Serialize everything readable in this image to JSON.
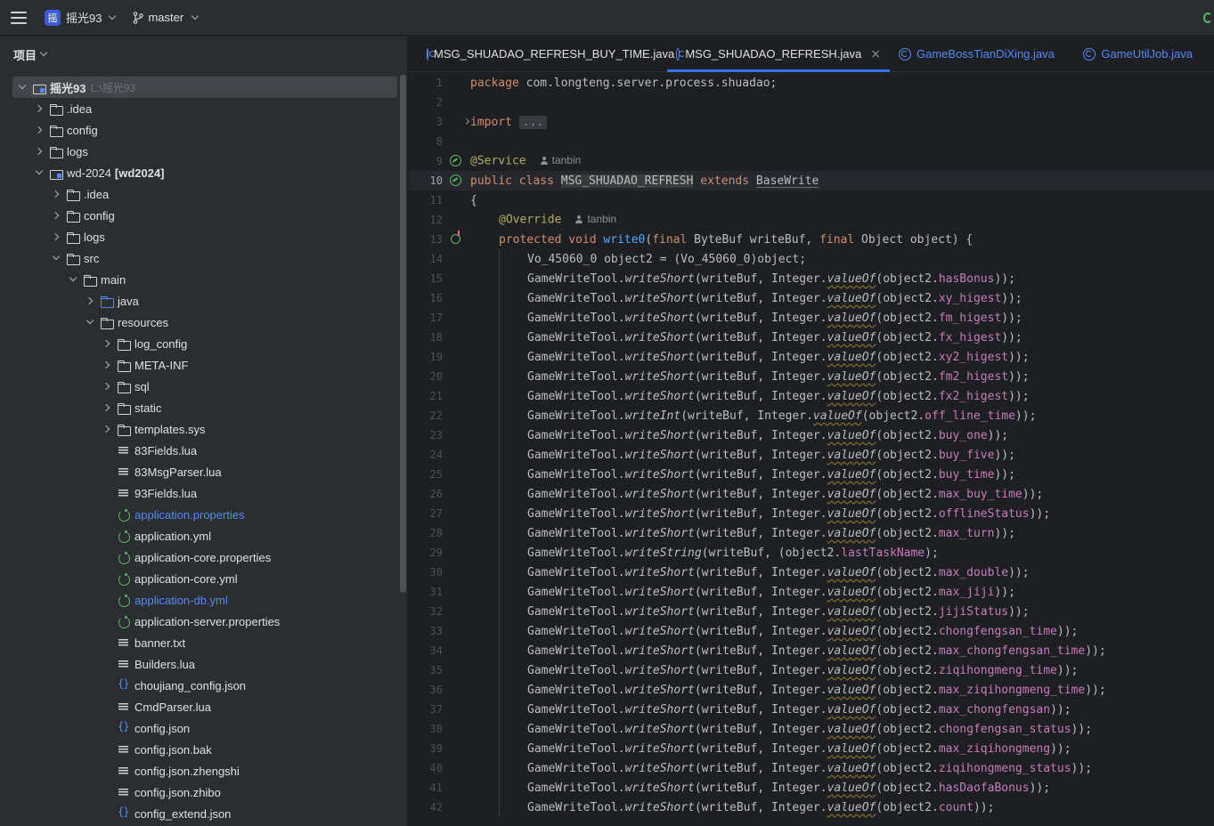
{
  "toolbar": {
    "project_badge": "摇",
    "project_name": "摇光93",
    "branch": "master"
  },
  "project_panel": {
    "title": "项目",
    "root": {
      "name": "摇光93",
      "path": "L:\\摇光93"
    },
    "tree": [
      {
        "depth": 1,
        "arrow": "closed",
        "icon": "folder",
        "label": ".idea"
      },
      {
        "depth": 1,
        "arrow": "closed",
        "icon": "folder",
        "label": "config"
      },
      {
        "depth": 1,
        "arrow": "closed",
        "icon": "folder",
        "label": "logs"
      },
      {
        "depth": 1,
        "arrow": "open",
        "icon": "module",
        "label": "wd-2024",
        "module": "[wd2024]"
      },
      {
        "depth": 2,
        "arrow": "closed",
        "icon": "folder",
        "label": ".idea"
      },
      {
        "depth": 2,
        "arrow": "closed",
        "icon": "folder",
        "label": "config"
      },
      {
        "depth": 2,
        "arrow": "closed",
        "icon": "folder",
        "label": "logs"
      },
      {
        "depth": 2,
        "arrow": "open",
        "icon": "folder",
        "label": "src"
      },
      {
        "depth": 3,
        "arrow": "open",
        "icon": "folder",
        "label": "main"
      },
      {
        "depth": 4,
        "arrow": "closed",
        "icon": "folder-blue",
        "label": "java"
      },
      {
        "depth": 4,
        "arrow": "open",
        "icon": "folder",
        "label": "resources"
      },
      {
        "depth": 5,
        "arrow": "closed",
        "icon": "folder",
        "label": "log_config"
      },
      {
        "depth": 5,
        "arrow": "closed",
        "icon": "folder",
        "label": "META-INF"
      },
      {
        "depth": 5,
        "arrow": "closed",
        "icon": "folder",
        "label": "sql"
      },
      {
        "depth": 5,
        "arrow": "closed",
        "icon": "folder",
        "label": "static"
      },
      {
        "depth": 5,
        "arrow": "closed",
        "icon": "folder",
        "label": "templates.sys"
      },
      {
        "depth": 5,
        "arrow": "none",
        "icon": "text",
        "label": "83Fields.lua"
      },
      {
        "depth": 5,
        "arrow": "none",
        "icon": "text",
        "label": "83MsgParser.lua"
      },
      {
        "depth": 5,
        "arrow": "none",
        "icon": "text",
        "label": "93Fields.lua"
      },
      {
        "depth": 5,
        "arrow": "none",
        "icon": "spring",
        "label": "application.properties",
        "color": "blue"
      },
      {
        "depth": 5,
        "arrow": "none",
        "icon": "spring",
        "label": "application.yml"
      },
      {
        "depth": 5,
        "arrow": "none",
        "icon": "spring",
        "label": "application-core.properties"
      },
      {
        "depth": 5,
        "arrow": "none",
        "icon": "spring",
        "label": "application-core.yml"
      },
      {
        "depth": 5,
        "arrow": "none",
        "icon": "spring",
        "label": "application-db.yml",
        "color": "blue"
      },
      {
        "depth": 5,
        "arrow": "none",
        "icon": "spring",
        "label": "application-server.properties"
      },
      {
        "depth": 5,
        "arrow": "none",
        "icon": "text",
        "label": "banner.txt"
      },
      {
        "depth": 5,
        "arrow": "none",
        "icon": "text",
        "label": "Builders.lua"
      },
      {
        "depth": 5,
        "arrow": "none",
        "icon": "json",
        "label": "choujiang_config.json"
      },
      {
        "depth": 5,
        "arrow": "none",
        "icon": "text",
        "label": "CmdParser.lua"
      },
      {
        "depth": 5,
        "arrow": "none",
        "icon": "json",
        "label": "config.json"
      },
      {
        "depth": 5,
        "arrow": "none",
        "icon": "text",
        "label": "config.json.bak"
      },
      {
        "depth": 5,
        "arrow": "none",
        "icon": "text",
        "label": "config.json.zhengshi"
      },
      {
        "depth": 5,
        "arrow": "none",
        "icon": "text",
        "label": "config.json.zhibo"
      },
      {
        "depth": 5,
        "arrow": "none",
        "icon": "json",
        "label": "config_extend.json"
      }
    ]
  },
  "editor": {
    "tabs": [
      {
        "label": "MSG_SHUADAO_REFRESH_BUY_TIME.java",
        "active": false,
        "blue": false
      },
      {
        "label": "MSG_SHUADAO_REFRESH.java",
        "active": true,
        "blue": false,
        "close": "×"
      },
      {
        "label": "GameBossTianDiXing.java",
        "active": false,
        "blue": true
      },
      {
        "label": "GameUtilJob.java",
        "active": false,
        "blue": true
      }
    ],
    "header_lines": {
      "l1": {
        "num": "1",
        "kw": "package",
        "rest": " com.longteng.server.process.shuadao;"
      },
      "l2": {
        "num": "2"
      },
      "l3": {
        "num": "3",
        "kw": "import",
        "fold": "..."
      },
      "l8": {
        "num": "8"
      },
      "l9": {
        "num": "9",
        "ann": "@Service",
        "author": "tanbin"
      },
      "l10": {
        "num": "10",
        "kw1": "public class",
        "cls": "MSG_SHUADAO_REFRESH",
        "kw2": "extends",
        "base": "BaseWrite"
      },
      "l11": {
        "num": "11",
        "text": "{"
      },
      "l12": {
        "num": "12",
        "ann": "@Override",
        "author": "tanbin"
      },
      "l13": {
        "num": "13",
        "kw1": "protected void",
        "fn": "write0",
        "p1": "(",
        "kw2": "final",
        "p2": " ByteBuf writeBuf, ",
        "kw3": "final",
        "p3": " Object object) {"
      },
      "l14": {
        "num": "14",
        "text": "Vo_45060_0 object2 = (Vo_45060_0)object;"
      }
    },
    "write_lines": [
      {
        "num": "15",
        "method": "writeShort",
        "wrap": true,
        "field": "hasBonus"
      },
      {
        "num": "16",
        "method": "writeShort",
        "wrap": true,
        "field": "xy_higest"
      },
      {
        "num": "17",
        "method": "writeShort",
        "wrap": true,
        "field": "fm_higest"
      },
      {
        "num": "18",
        "method": "writeShort",
        "wrap": true,
        "field": "fx_higest"
      },
      {
        "num": "19",
        "method": "writeShort",
        "wrap": true,
        "field": "xy2_higest"
      },
      {
        "num": "20",
        "method": "writeShort",
        "wrap": true,
        "field": "fm2_higest"
      },
      {
        "num": "21",
        "method": "writeShort",
        "wrap": true,
        "field": "fx2_higest"
      },
      {
        "num": "22",
        "method": "writeInt",
        "wrap": true,
        "field": "off_line_time"
      },
      {
        "num": "23",
        "method": "writeShort",
        "wrap": true,
        "field": "buy_one"
      },
      {
        "num": "24",
        "method": "writeShort",
        "wrap": true,
        "field": "buy_five"
      },
      {
        "num": "25",
        "method": "writeShort",
        "wrap": true,
        "field": "buy_time"
      },
      {
        "num": "26",
        "method": "writeShort",
        "wrap": true,
        "field": "max_buy_time"
      },
      {
        "num": "27",
        "method": "writeShort",
        "wrap": true,
        "field": "offlineStatus"
      },
      {
        "num": "28",
        "method": "writeShort",
        "wrap": true,
        "field": "max_turn"
      },
      {
        "num": "29",
        "method": "writeString",
        "wrap": false,
        "field": "lastTaskName"
      },
      {
        "num": "30",
        "method": "writeShort",
        "wrap": true,
        "field": "max_double"
      },
      {
        "num": "31",
        "method": "writeShort",
        "wrap": true,
        "field": "max_jiji"
      },
      {
        "num": "32",
        "method": "writeShort",
        "wrap": true,
        "field": "jijiStatus"
      },
      {
        "num": "33",
        "method": "writeShort",
        "wrap": true,
        "field": "chongfengsan_time"
      },
      {
        "num": "34",
        "method": "writeShort",
        "wrap": true,
        "field": "max_chongfengsan_time"
      },
      {
        "num": "35",
        "method": "writeShort",
        "wrap": true,
        "field": "ziqihongmeng_time"
      },
      {
        "num": "36",
        "method": "writeShort",
        "wrap": true,
        "field": "max_ziqihongmeng_time"
      },
      {
        "num": "37",
        "method": "writeShort",
        "wrap": true,
        "field": "max_chongfengsan"
      },
      {
        "num": "38",
        "method": "writeShort",
        "wrap": true,
        "field": "chongfengsan_status"
      },
      {
        "num": "39",
        "method": "writeShort",
        "wrap": true,
        "field": "max_ziqihongmeng"
      },
      {
        "num": "40",
        "method": "writeShort",
        "wrap": true,
        "field": "ziqihongmeng_status"
      },
      {
        "num": "41",
        "method": "writeShort",
        "wrap": true,
        "field": "hasDaofaBonus"
      },
      {
        "num": "42",
        "method": "writeShort",
        "wrap": true,
        "field": "count"
      }
    ],
    "tokens": {
      "tool": "GameWriteTool.",
      "buf_open": "(writeBuf, ",
      "integer": "Integer.",
      "valueof": "valueOf",
      "obj_open": "(object2.",
      "close_wrap": "));",
      "close_plain": ");"
    }
  },
  "colors": {
    "keyword": "#cf8e6d",
    "field": "#c77dbb",
    "annotation": "#b3ae60",
    "function": "#56a8f5",
    "accent": "#3574f0"
  }
}
